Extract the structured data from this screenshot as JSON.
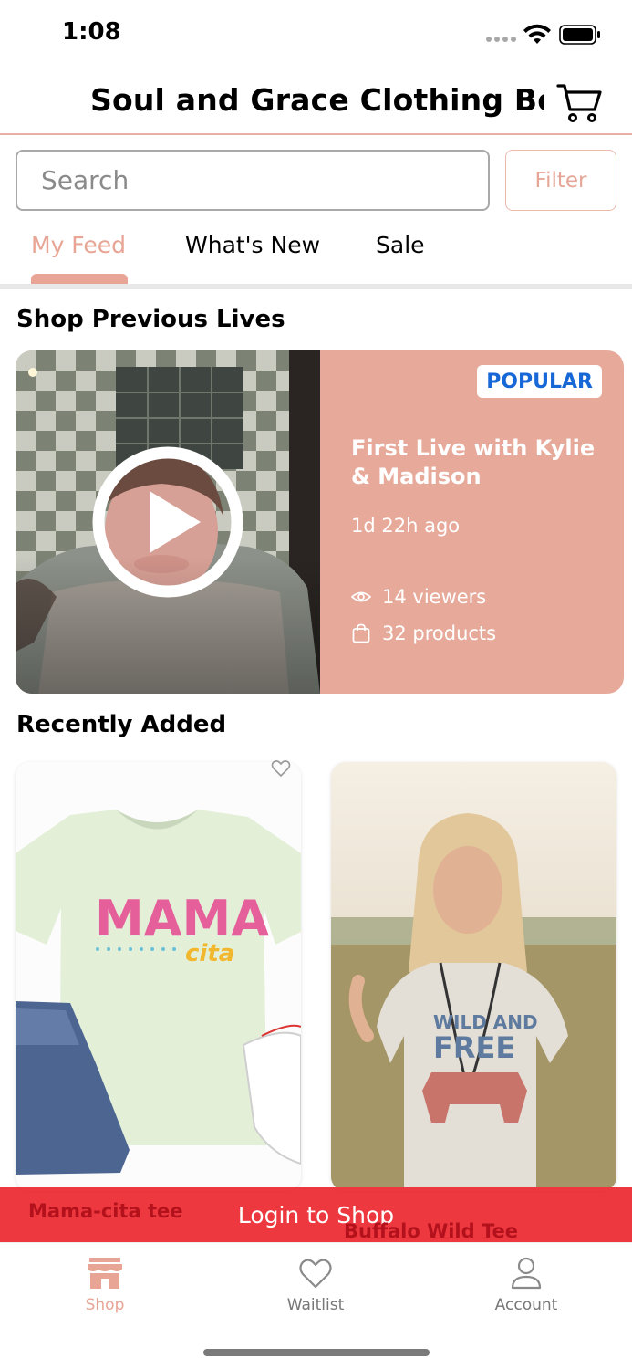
{
  "status": {
    "time": "1:08"
  },
  "header": {
    "title": "Soul and Grace Clothing Boutiq",
    "cart_icon": "shopping-cart-icon"
  },
  "search": {
    "placeholder": "Search",
    "value": ""
  },
  "filter": {
    "label": "Filter"
  },
  "tabs": [
    {
      "label": "My Feed",
      "active": true
    },
    {
      "label": "What's New",
      "active": false
    },
    {
      "label": "Sale",
      "active": false
    }
  ],
  "sections": {
    "lives_title": "Shop Previous Lives",
    "recent_title": "Recently Added"
  },
  "live": {
    "badge": "POPULAR",
    "title": "First Live with Kylie & Madison",
    "time_ago": "1d 22h ago",
    "viewers": "14 viewers",
    "products": "32 products"
  },
  "products": [
    {
      "name": "Mama-cita tee",
      "shirt_text_1": "MAMA",
      "shirt_text_2": "cita"
    },
    {
      "name": "Buffalo Wild Tee",
      "shirt_text_1": "WILD AND",
      "shirt_text_2": "FREE"
    }
  ],
  "login_banner": "Login to Shop",
  "nav": [
    {
      "label": "Shop",
      "icon": "storefront-icon",
      "active": true
    },
    {
      "label": "Waitlist",
      "icon": "heart-icon",
      "active": false
    },
    {
      "label": "Account",
      "icon": "person-icon",
      "active": false
    }
  ],
  "colors": {
    "accent": "#e8a596",
    "live_card": "#e7aa9a",
    "badge_text": "#1768d6",
    "banner": "#ec1c24",
    "product_name": "#b3121c"
  }
}
